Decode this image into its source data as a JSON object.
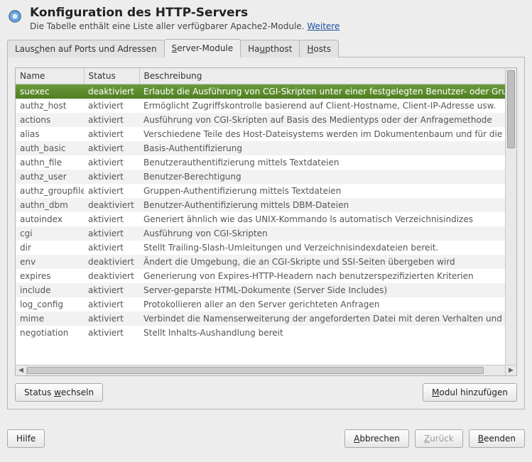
{
  "header": {
    "title": "Konfiguration des HTTP-Servers",
    "subtitle_pre": "Die Tabelle enthält eine Liste aller verfügbarer Apache2-Module. ",
    "subtitle_link": "Weitere"
  },
  "tabs": [
    {
      "label_pre": "Laus",
      "label_u": "c",
      "label_post": "hen auf Ports und Adressen"
    },
    {
      "label_pre": "",
      "label_u": "S",
      "label_post": "erver-Module"
    },
    {
      "label_pre": "Ha",
      "label_u": "u",
      "label_post": "pthost"
    },
    {
      "label_pre": "",
      "label_u": "H",
      "label_post": "osts"
    }
  ],
  "active_tab_index": 1,
  "table": {
    "columns": {
      "name": "Name",
      "status": "Status",
      "desc": "Beschreibung"
    },
    "rows": [
      {
        "name": "suexec",
        "status": "deaktiviert",
        "desc": "Erlaubt die Ausführung von CGI-Skripten unter einer festgelegten Benutzer- oder Gruppe",
        "selected": true
      },
      {
        "name": "authz_host",
        "status": "aktiviert",
        "desc": "Ermöglicht Zugriffskontrolle basierend auf Client-Hostname, Client-IP-Adresse usw."
      },
      {
        "name": "actions",
        "status": "aktiviert",
        "desc": "Ausführung von CGI-Skripten auf Basis des Medientyps oder der Anfragemethode"
      },
      {
        "name": "alias",
        "status": "aktiviert",
        "desc": "Verschiedene Teile des Host-Dateisystems werden im Dokumentenbaum und für die UR"
      },
      {
        "name": "auth_basic",
        "status": "aktiviert",
        "desc": "Basis-Authentifizierung"
      },
      {
        "name": "authn_file",
        "status": "aktiviert",
        "desc": "Benutzerauthentifizierung mittels Textdateien"
      },
      {
        "name": "authz_user",
        "status": "aktiviert",
        "desc": "Benutzer-Berechtigung"
      },
      {
        "name": "authz_groupfile",
        "status": "aktiviert",
        "desc": "Gruppen-Authentifizierung mittels Textdateien"
      },
      {
        "name": "authn_dbm",
        "status": "deaktiviert",
        "desc": "Benutzer-Authentifizierung mittels DBM-Dateien"
      },
      {
        "name": "autoindex",
        "status": "aktiviert",
        "desc": "Generiert ähnlich wie das UNIX-Kommando ls automatisch Verzeichnisindizes"
      },
      {
        "name": "cgi",
        "status": "aktiviert",
        "desc": "Ausführung von CGI-Skripten"
      },
      {
        "name": "dir",
        "status": "aktiviert",
        "desc": "Stellt Trailing-Slash-Umleitungen und Verzeichnisindexdateien bereit."
      },
      {
        "name": "env",
        "status": "deaktiviert",
        "desc": "Ändert die Umgebung, die an CGI-Skripte und SSI-Seiten übergeben wird"
      },
      {
        "name": "expires",
        "status": "deaktiviert",
        "desc": "Generierung von Expires-HTTP-Headern nach benutzerspezifizierten Kriterien"
      },
      {
        "name": "include",
        "status": "aktiviert",
        "desc": "Server-geparste HTML-Dokumente (Server Side Includes)"
      },
      {
        "name": "log_config",
        "status": "aktiviert",
        "desc": "Protokollieren aller an den Server gerichteten Anfragen"
      },
      {
        "name": "mime",
        "status": "aktiviert",
        "desc": "Verbindet die Namenserweiterung der angeforderten Datei mit deren Verhalten und Inha"
      },
      {
        "name": "negotiation",
        "status": "aktiviert",
        "desc": "Stellt Inhalts-Aushandlung bereit"
      }
    ]
  },
  "panel_buttons": {
    "toggle_pre": "Status ",
    "toggle_u": "w",
    "toggle_post": "echseln",
    "add_pre": "",
    "add_u": "M",
    "add_post": "odul hinzufügen"
  },
  "footer": {
    "help": "Hilfe",
    "cancel_pre": "",
    "cancel_u": "A",
    "cancel_post": "bbrechen",
    "back_pre": "",
    "back_u": "Z",
    "back_post": "urück",
    "finish_pre": "",
    "finish_u": "B",
    "finish_post": "eenden"
  }
}
